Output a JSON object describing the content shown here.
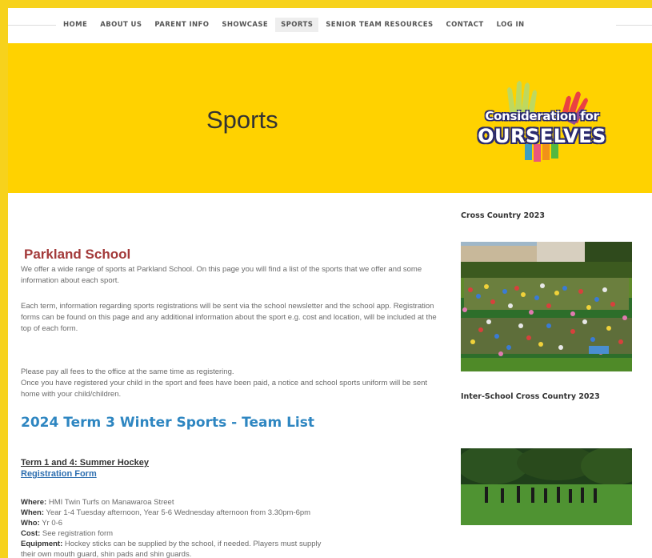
{
  "nav": {
    "items": [
      {
        "label": "HOME"
      },
      {
        "label": "ABOUT US"
      },
      {
        "label": "PARENT INFO"
      },
      {
        "label": "SHOWCASE"
      },
      {
        "label": "SPORTS"
      },
      {
        "label": "SENIOR TEAM RESOURCES"
      },
      {
        "label": "CONTACT"
      },
      {
        "label": "LOG IN"
      }
    ],
    "active": "SPORTS"
  },
  "banner": {
    "title": "Sports",
    "logo_line1": "Consideration for",
    "logo_line2": "OURSELVES"
  },
  "main": {
    "school_name": "Parkland School",
    "intro": "We offer a wide range of sports at Parkland School. On this page you will find a list of the sports that we offer and some information about each sport.",
    "registration_info": "Each term, information regarding sports registrations will be sent via the school newsletter and the school app. Registration forms can be found on this page and any additional information about the sport e.g. cost and location, will be included at the top of each form.",
    "fees_info": "Please pay all fees to the office at the same time as registering.",
    "uniform_info": "Once you have registered your child in the sport and fees have been paid, a notice and school sports uniform will be sent home with your child/children.",
    "team_list_heading": "2024 Term 3 Winter Sports - Team List",
    "section": {
      "heading": "Term 1 and 4: Summer Hockey",
      "link": "Registration Form",
      "where_label": "Where:",
      "where": "HMI Twin Turfs on Manawaroa Street",
      "when_label": "When:",
      "when": "Year 1-4 Tuesday afternoon, Year 5-6 Wednesday afternoon from 3.30pm-6pm",
      "who_label": "Who:",
      "who": "Yr 0-6",
      "cost_label": "Cost:",
      "cost": "See registration form",
      "equipment_label": "Equipment:",
      "equipment": "Hockey sticks can be supplied by the school, if needed. Players must supply",
      "equipment_cont": "their own mouth guard, shin pads and shin guards."
    }
  },
  "sidebar": {
    "heading1": "Cross Country 2023",
    "heading2": "Inter-School Cross Country 2023"
  },
  "colors": {
    "brand_yellow": "#ffd200",
    "school_name": "#a33a3a",
    "link_blue": "#2e86c1"
  }
}
